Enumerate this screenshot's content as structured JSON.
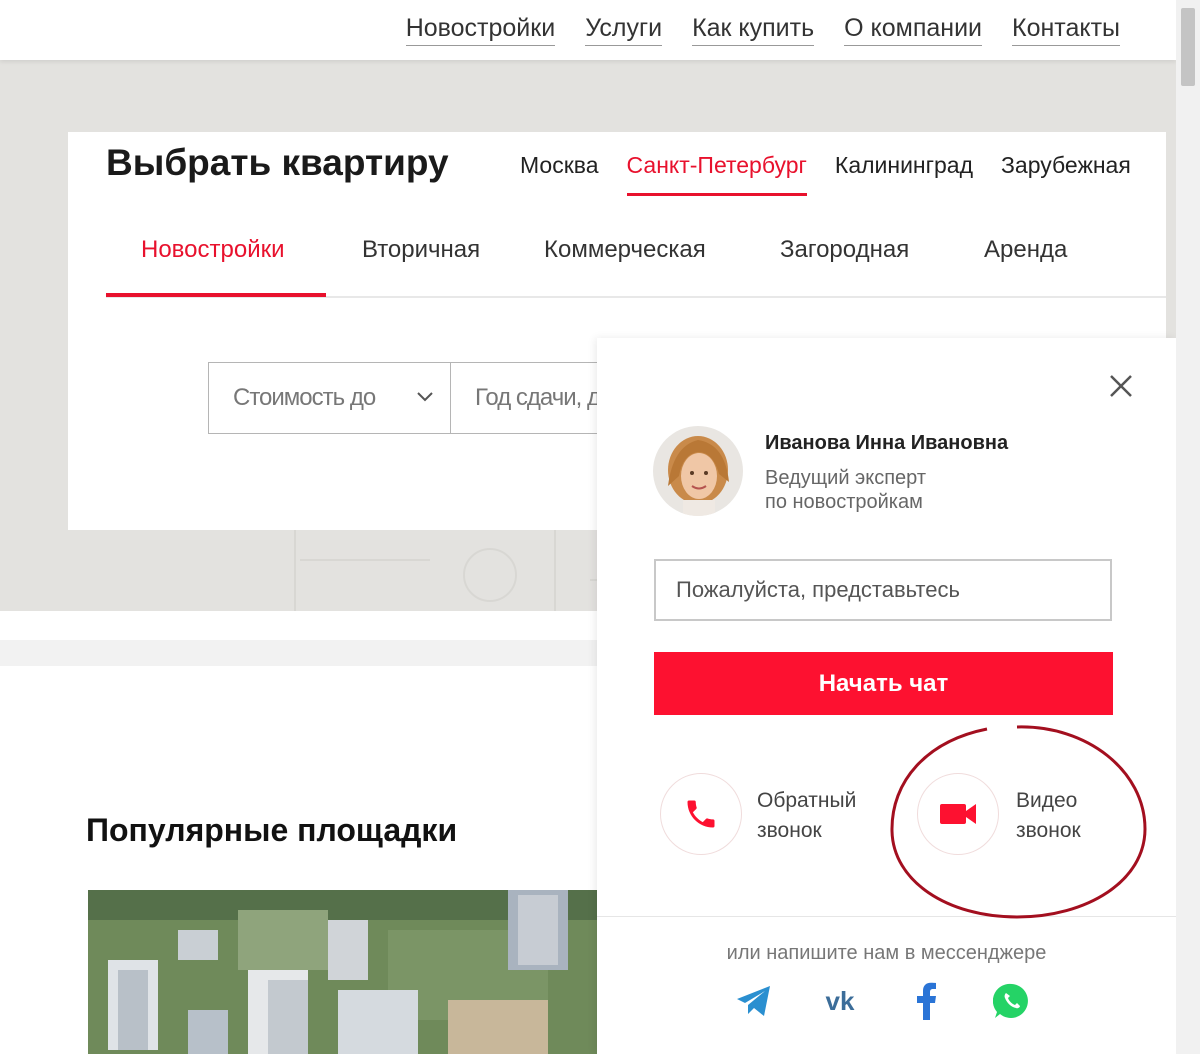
{
  "nav": {
    "items": [
      "Новостройки",
      "Услуги",
      "Как купить",
      "О компании",
      "Контакты"
    ]
  },
  "search": {
    "title": "Выбрать квартиру",
    "cities": [
      "Москва",
      "Санкт-Петербург",
      "Калининград",
      "Зарубежная"
    ],
    "active_city": "Санкт-Петербург",
    "types": [
      "Новостройки",
      "Вторичная",
      "Коммерческая",
      "Загородная",
      "Аренда"
    ],
    "active_type": "Новостройки",
    "price_select": "Стоимость до",
    "year_select": "Год сдачи, д"
  },
  "popular": {
    "title": "Популярные площадки"
  },
  "chat": {
    "agent_name": "Иванова Инна Ивановна",
    "agent_role": "Ведущий эксперт\nпо  новостройкам",
    "name_placeholder": "Пожалуйста, представьтесь",
    "start_button": "Начать чат",
    "callback_label": "Обратный\nзвонок",
    "video_label": "Видео\nзвонок",
    "messenger_text": "или напишите нам в мессенджере",
    "messengers": [
      "telegram-icon",
      "vk-icon",
      "facebook-icon",
      "whatsapp-icon"
    ]
  },
  "colors": {
    "accent": "#fd1130",
    "annotation": "#a30f1f"
  }
}
